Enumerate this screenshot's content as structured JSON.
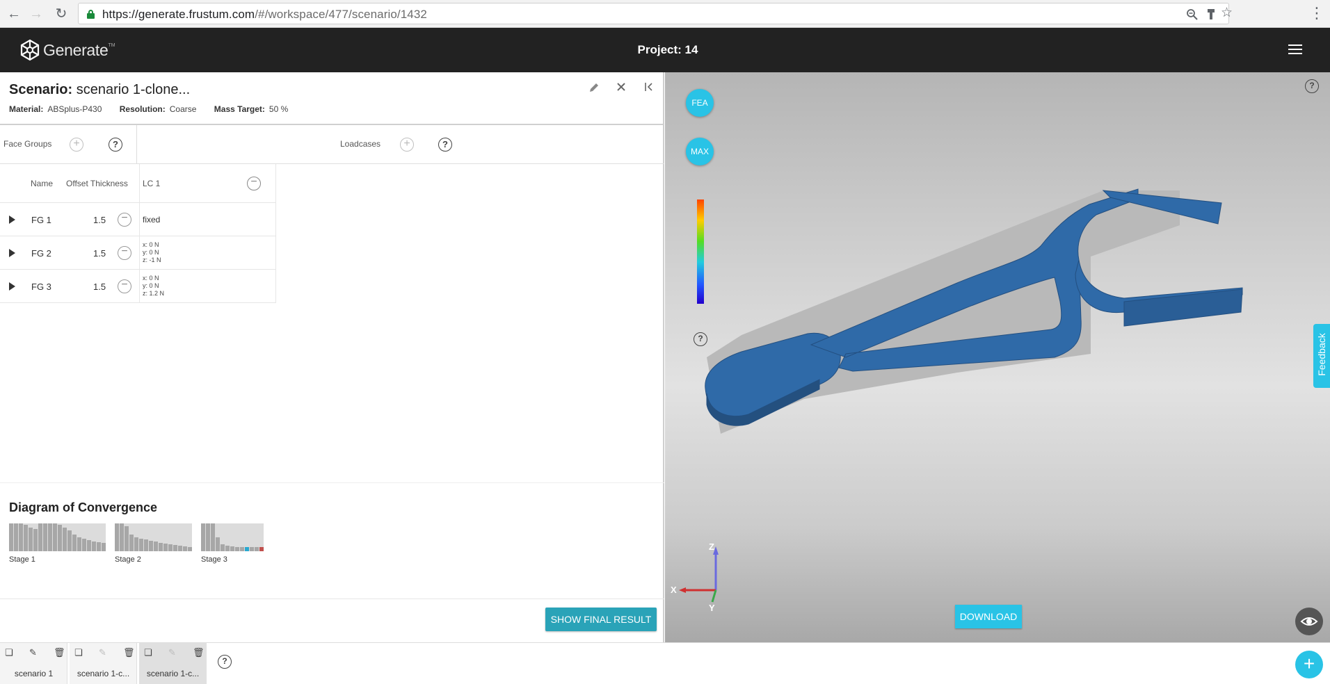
{
  "browser": {
    "url_host": "https://generate.frustum.com",
    "url_path": "/#/workspace/477/scenario/1432"
  },
  "app": {
    "logo_text": "Generate",
    "logo_tm": "TM",
    "project_title": "Project: 14"
  },
  "scenario": {
    "title_key": "Scenario:",
    "title_value": "scenario 1-clone...",
    "material_key": "Material:",
    "material_value": "ABSplus-P430",
    "resolution_key": "Resolution:",
    "resolution_value": "Coarse",
    "mass_key": "Mass Target:",
    "mass_value": "50 %"
  },
  "tabs": {
    "face_groups": "Face Groups",
    "loadcases": "Loadcases"
  },
  "table": {
    "col_name": "Name",
    "col_offset": "Offset Thickness",
    "col_lc": "LC 1",
    "rows": [
      {
        "name": "FG 1",
        "thickness": "1.5",
        "lc": "fixed",
        "lc_x": "",
        "lc_y": "",
        "lc_z": ""
      },
      {
        "name": "FG 2",
        "thickness": "1.5",
        "lc": "",
        "lc_x": "x: 0 N",
        "lc_y": "y: 0 N",
        "lc_z": "z: -1 N"
      },
      {
        "name": "FG 3",
        "thickness": "1.5",
        "lc": "",
        "lc_x": "x: 0 N",
        "lc_y": "y: 0 N",
        "lc_z": "z: 1.2 N"
      }
    ]
  },
  "convergence": {
    "title": "Diagram of Convergence",
    "stages": [
      {
        "label": "Stage 1",
        "values": [
          1.0,
          1.0,
          1.0,
          0.95,
          0.85,
          0.8,
          1.0,
          1.0,
          1.0,
          1.0,
          0.95,
          0.85,
          0.75,
          0.6,
          0.5,
          0.45,
          0.4,
          0.35,
          0.32,
          0.3
        ]
      },
      {
        "label": "Stage 2",
        "values": [
          1.0,
          1.0,
          0.9,
          0.6,
          0.5,
          0.45,
          0.42,
          0.38,
          0.35,
          0.3,
          0.28,
          0.25,
          0.22,
          0.2,
          0.18,
          0.16
        ]
      },
      {
        "label": "Stage 3",
        "values": [
          1.0,
          1.0,
          1.0,
          0.5,
          0.25,
          0.2,
          0.18,
          0.15,
          0.14,
          0.14,
          0.14,
          0.14,
          0.14
        ]
      }
    ]
  },
  "actions": {
    "show_final": "SHOW FINAL RESULT",
    "download": "DOWNLOAD",
    "fea": "FEA",
    "max": "MAX",
    "feedback": "Feedback",
    "help": "?",
    "add": "+"
  },
  "axes": {
    "x": "X",
    "y": "Y",
    "z": "Z"
  },
  "scenario_tabs": [
    {
      "label": "scenario 1",
      "editable": true
    },
    {
      "label": "scenario 1-c...",
      "editable": false
    },
    {
      "label": "scenario 1-c...",
      "editable": false
    }
  ],
  "colors": {
    "accent": "#29c3e6",
    "button_teal": "#2aa3b8",
    "model_blue": "#2f6aa8",
    "header_bg": "#222222"
  }
}
